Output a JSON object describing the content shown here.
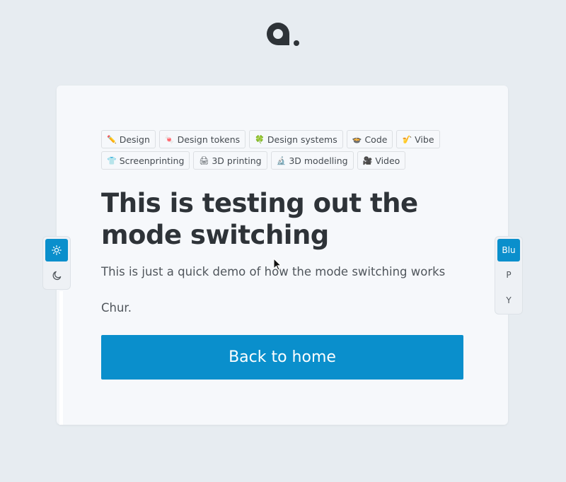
{
  "logo": {
    "icon": "q-dot-logo-icon"
  },
  "tags": {
    "row1": [
      {
        "emoji": "✏️",
        "label": "Design"
      },
      {
        "emoji": "🍬",
        "label": "Design tokens"
      },
      {
        "emoji": "🍀",
        "label": "Design systems"
      },
      {
        "emoji": "🍲",
        "label": "Code"
      },
      {
        "emoji": "🎷",
        "label": "Vibe"
      }
    ],
    "row2": [
      {
        "emoji": "👕",
        "label": "Screenprinting"
      },
      {
        "emoji": "🖨",
        "label": "3D printing"
      },
      {
        "emoji": "🔬",
        "label": "3D modelling"
      },
      {
        "emoji": "🎥",
        "label": "Video"
      }
    ]
  },
  "main": {
    "headline": "This is testing out the mode switching",
    "subtext": "This is just a quick demo of how the mode switching works",
    "signoff": "Chur.",
    "cta_label": "Back to home"
  },
  "mode_switch": {
    "light_icon": "sun-icon",
    "dark_icon": "moon-icon",
    "active": "light"
  },
  "color_switch": {
    "options": [
      "Blu",
      "P",
      "Y"
    ],
    "active": "Blu"
  },
  "colors": {
    "accent": "#0a8fcc",
    "background": "#e7ecf1",
    "card": "#f6f8fb",
    "text": "#2e3338"
  }
}
